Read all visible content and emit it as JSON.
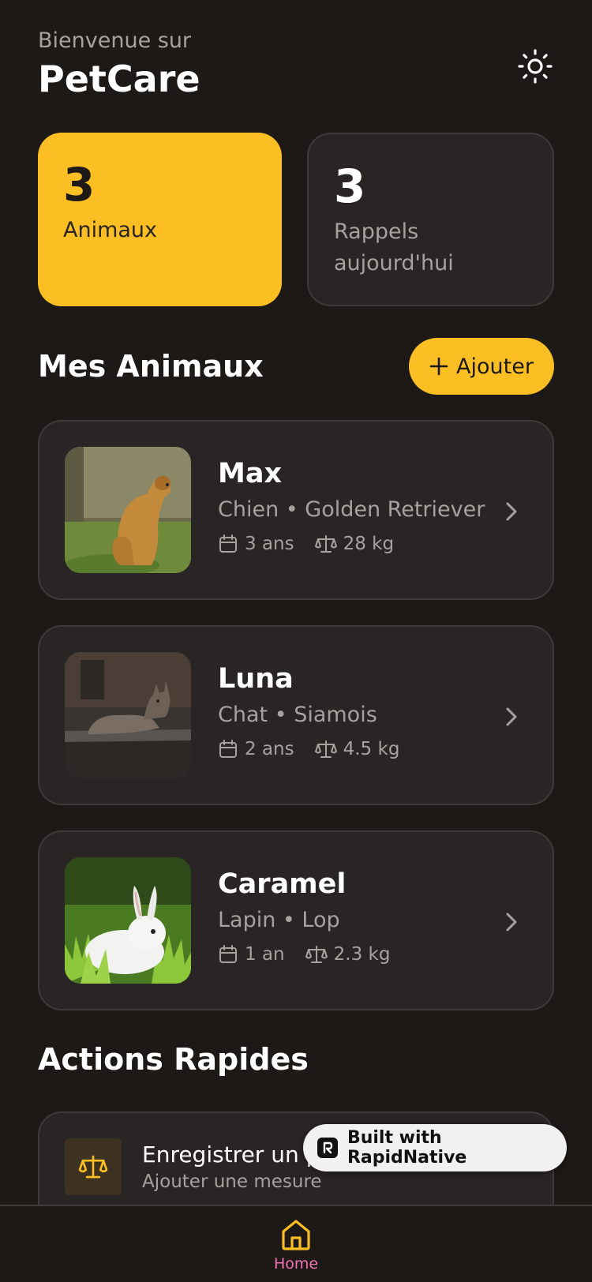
{
  "header": {
    "welcome": "Bienvenue sur",
    "title": "PetCare"
  },
  "stats": [
    {
      "value": "3",
      "label": "Animaux"
    },
    {
      "value": "3",
      "label": "Rappels aujourd'hui"
    }
  ],
  "pets_section": {
    "title": "Mes Animaux",
    "add_label": "Ajouter"
  },
  "pets": [
    {
      "name": "Max",
      "breed": "Chien • Golden Retriever",
      "age": "3 ans",
      "weight": "28 kg"
    },
    {
      "name": "Luna",
      "breed": "Chat • Siamois",
      "age": "2 ans",
      "weight": "4.5 kg"
    },
    {
      "name": "Caramel",
      "breed": "Lapin • Lop",
      "age": "1 an",
      "weight": "2.3 kg"
    }
  ],
  "actions": {
    "title": "Actions Rapides",
    "items": [
      {
        "title": "Enregistrer un poids",
        "subtitle": "Ajouter une mesure",
        "icon": "scale-icon"
      }
    ]
  },
  "badge": {
    "text": "Built with RapidNative"
  },
  "nav": {
    "home_label": "Home"
  },
  "colors": {
    "accent": "#fbbf24",
    "background": "#1c1917",
    "card": "#292524",
    "nav_active": "#f472b6"
  }
}
